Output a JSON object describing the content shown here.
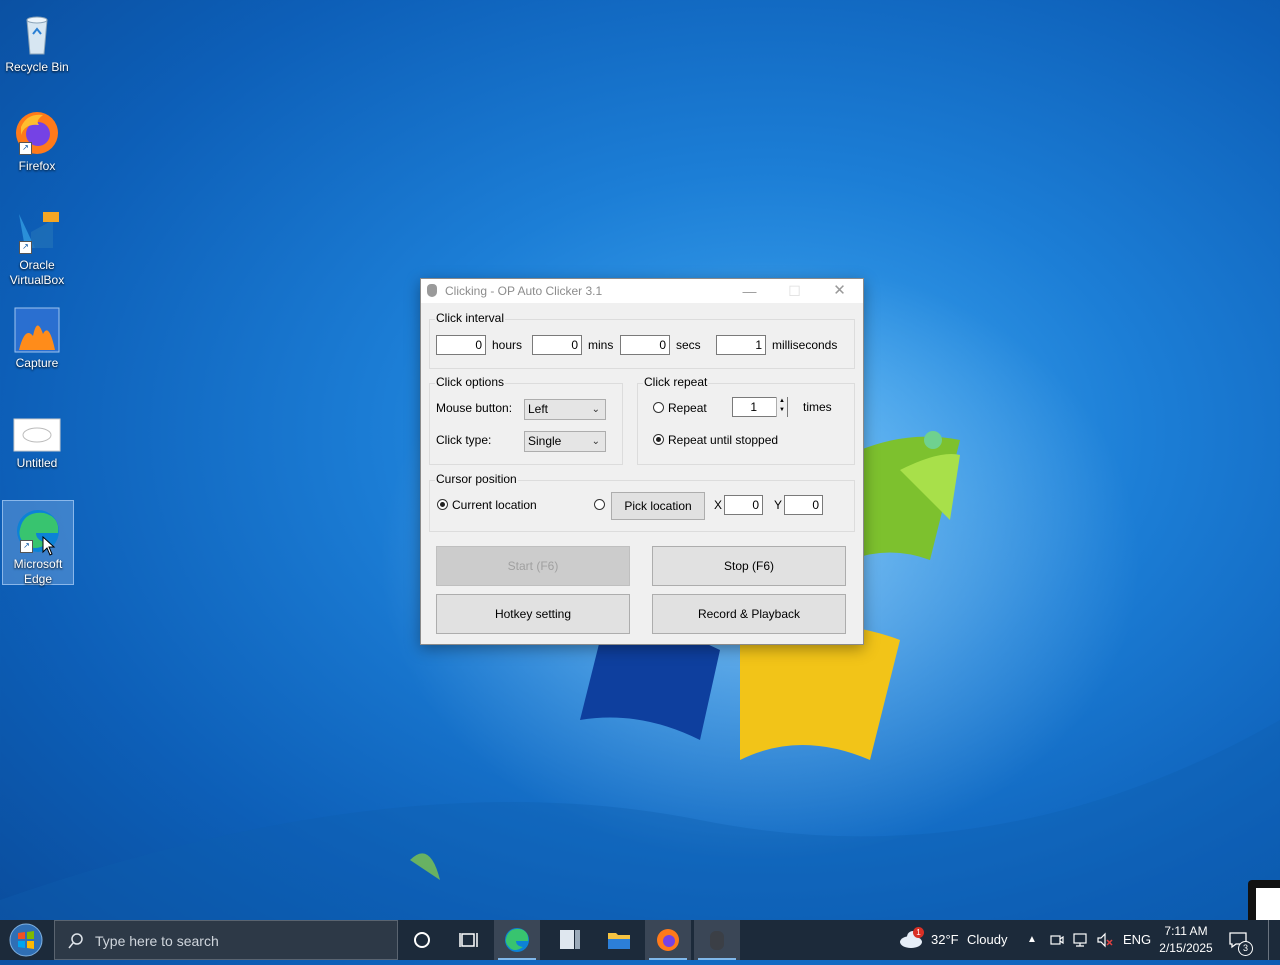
{
  "desktop": {
    "icons": [
      {
        "label": "Recycle Bin"
      },
      {
        "label": "Firefox"
      },
      {
        "label": "Oracle VirtualBox"
      },
      {
        "label": "Capture"
      },
      {
        "label": "Untitled"
      },
      {
        "label": "Microsoft Edge"
      }
    ]
  },
  "window": {
    "title": "Clicking - OP Auto Clicker 3.1",
    "minimize": "—",
    "maximize": "☐",
    "close": "✕",
    "click_interval": {
      "label": "Click interval",
      "hours_value": "0",
      "hours_label": "hours",
      "mins_value": "0",
      "mins_label": "mins",
      "secs_value": "0",
      "secs_label": "secs",
      "ms_value": "1",
      "ms_label": "milliseconds"
    },
    "click_options": {
      "label": "Click options",
      "mouse_button_label": "Mouse button:",
      "mouse_button_value": "Left",
      "click_type_label": "Click type:",
      "click_type_value": "Single"
    },
    "click_repeat": {
      "label": "Click repeat",
      "repeat_label": "Repeat",
      "repeat_value": "1",
      "times_label": "times",
      "until_stopped_label": "Repeat until stopped"
    },
    "cursor_position": {
      "label": "Cursor position",
      "current_location_label": "Current location",
      "pick_location_label": "Pick location",
      "x_label": "X",
      "x_value": "0",
      "y_label": "Y",
      "y_value": "0"
    },
    "buttons": {
      "start": "Start (F6)",
      "stop": "Stop (F6)",
      "hotkey": "Hotkey setting",
      "record": "Record & Playback"
    }
  },
  "taskbar": {
    "search_placeholder": "Type here to search",
    "weather_temp": "32°F",
    "weather_text": "Cloudy",
    "weather_badge": "1",
    "language": "ENG",
    "time": "7:11 AM",
    "date": "2/15/2025",
    "notification_count": "3"
  },
  "colors": {
    "accent": "#1c7ed6",
    "taskbar": "#1c2a3a",
    "window_bg": "#f0f0f0"
  }
}
